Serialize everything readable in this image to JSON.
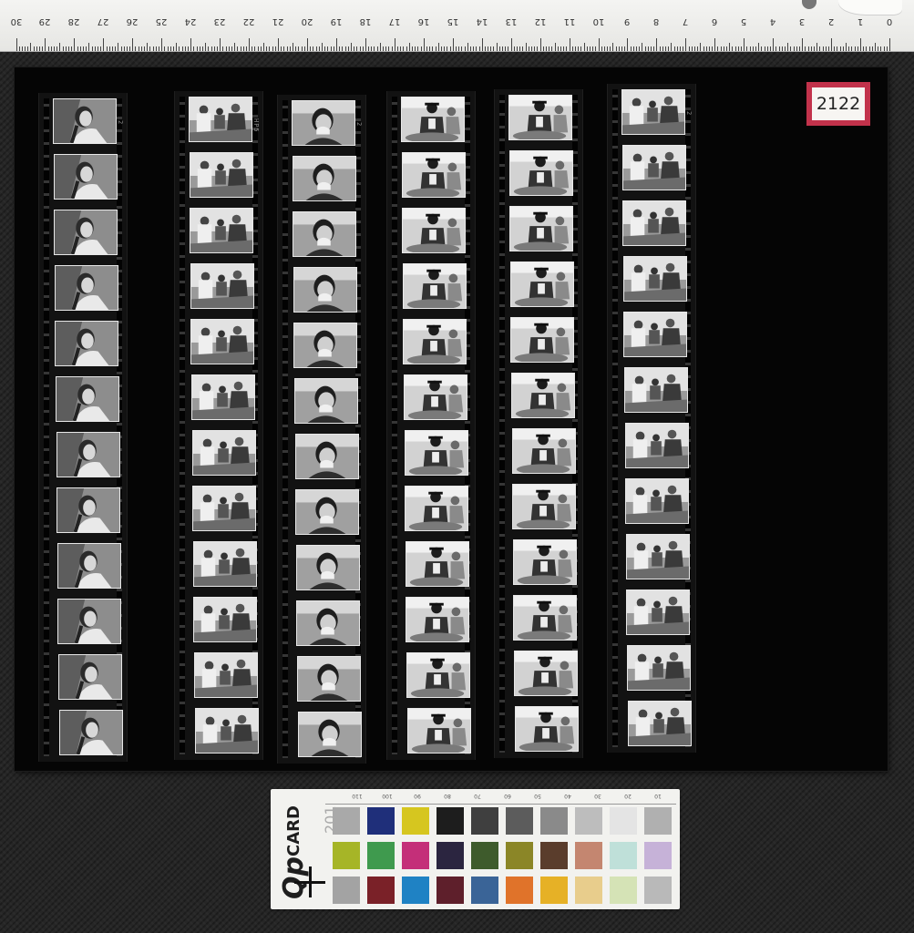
{
  "ruler": {
    "numbers": [
      "0",
      "1",
      "2",
      "3",
      "4",
      "5",
      "6",
      "7",
      "8",
      "9",
      "10",
      "11",
      "12",
      "13",
      "14",
      "15",
      "16",
      "17",
      "18",
      "19",
      "20",
      "21",
      "22",
      "23",
      "24",
      "25",
      "26",
      "27",
      "28",
      "29",
      "30"
    ]
  },
  "sheet_label": "2122",
  "film_edge_text": {
    "strip1": "2",
    "strip2": "HP5",
    "strip3": "2",
    "strip6": "2"
  },
  "color_card": {
    "brand_prefix": "Qp",
    "brand_word": "CARD",
    "brand_year": "201",
    "scale_numbers": [
      "110",
      "100",
      "90",
      "80",
      "70",
      "60",
      "50",
      "40",
      "30",
      "20",
      "10"
    ],
    "swatch_colors": [
      [
        "#a9a9a9",
        "#1f2f7a",
        "#d6c61f",
        "#1d1d1d",
        "#3f3f3f",
        "#5c5c5c",
        "#8a8a8a",
        "#bdbdbd",
        "#e4e4e4",
        "#b0b0b0"
      ],
      [
        "#a6b527",
        "#3f9a4e",
        "#c42f79",
        "#2b2540",
        "#3e5b2c",
        "#8b8627",
        "#5a3d2c",
        "#c48670",
        "#bfe0d9",
        "#c6b2d8"
      ],
      [
        "#a3a3a3",
        "#7a2128",
        "#1f82c4",
        "#5e1f2b",
        "#3a6497",
        "#e0732a",
        "#e6b126",
        "#e8cd8c",
        "#d5e3b6",
        "#b9b9b9"
      ]
    ]
  }
}
